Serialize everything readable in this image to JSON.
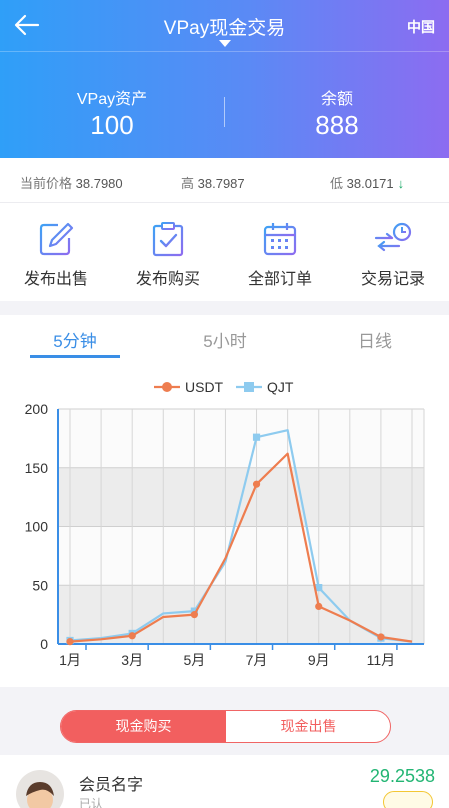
{
  "header": {
    "title": "VPay现金交易",
    "region": "中国"
  },
  "assets": {
    "vpay_label": "VPay资产",
    "vpay_value": "100",
    "balance_label": "余额",
    "balance_value": "888"
  },
  "price_strip": {
    "current_label": "当前价格",
    "current_value": "38.7980",
    "high_label": "高",
    "high_value": "38.7987",
    "low_label": "低",
    "low_value": "38.0171"
  },
  "actions": [
    {
      "label": "发布出售",
      "icon": "edit-icon"
    },
    {
      "label": "发布购买",
      "icon": "clipboard-check-icon"
    },
    {
      "label": "全部订单",
      "icon": "calendar-icon"
    },
    {
      "label": "交易记录",
      "icon": "exchange-clock-icon"
    }
  ],
  "tabs": [
    {
      "label": "5分钟",
      "active": true
    },
    {
      "label": "5小时",
      "active": false
    },
    {
      "label": "日线",
      "active": false
    }
  ],
  "chart_data": {
    "type": "line",
    "x": [
      0,
      1,
      2,
      3,
      4,
      5,
      6,
      7,
      8,
      9,
      10,
      11
    ],
    "x_tick_labels": [
      "1月",
      "3月",
      "5月",
      "7月",
      "9月",
      "11月"
    ],
    "ylim": [
      0,
      200
    ],
    "y_ticks": [
      0,
      50,
      100,
      150,
      200
    ],
    "grid": true,
    "legend_position": "top-center",
    "series": [
      {
        "name": "USDT",
        "color": "#ee7d4f",
        "values": [
          2,
          4,
          7,
          23,
          25,
          73,
          136,
          162,
          32,
          20,
          6,
          2
        ],
        "markers": [
          0,
          2,
          4,
          6,
          8,
          10
        ]
      },
      {
        "name": "QJT",
        "color": "#8ecbef",
        "values": [
          3,
          5,
          9,
          26,
          28,
          70,
          176,
          182,
          48,
          20,
          5,
          2
        ],
        "markers": [
          0,
          2,
          4,
          6,
          8,
          10
        ]
      }
    ]
  },
  "trade": {
    "buy_label": "现金购买",
    "sell_label": "现金出售"
  },
  "member": {
    "name": "会员名字",
    "sub": "已认",
    "price": "29.2538"
  }
}
